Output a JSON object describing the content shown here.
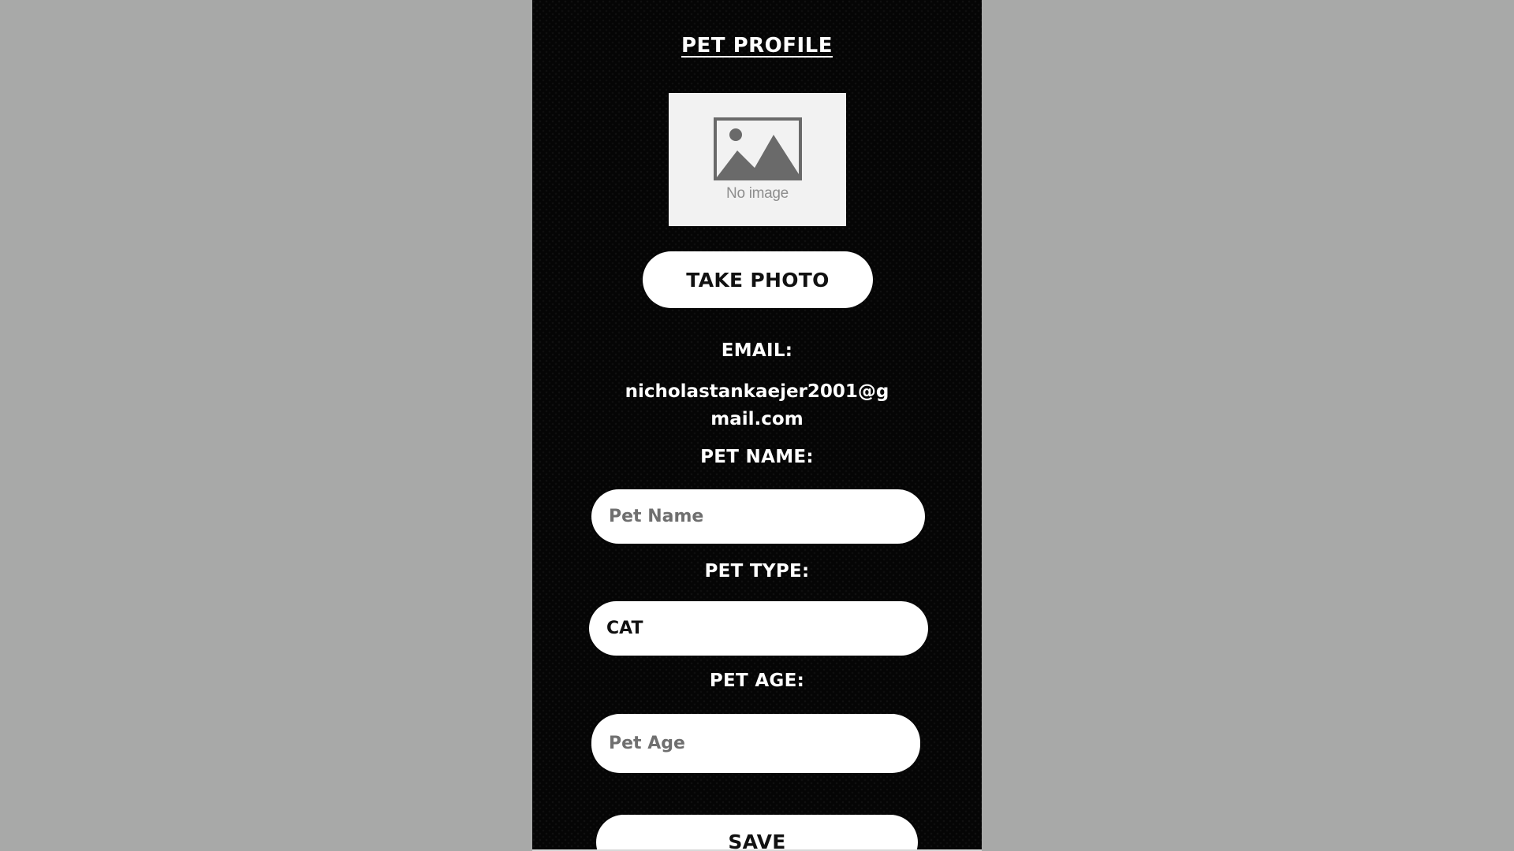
{
  "page": {
    "title": "PET PROFILE"
  },
  "photo": {
    "placeholder_text": "No image",
    "icon": "image-placeholder-icon"
  },
  "buttons": {
    "take_photo": "TAKE PHOTO",
    "save": "SAVE"
  },
  "email": {
    "label": "EMAIL:",
    "value": "nicholastankaejer2001@gmail.com"
  },
  "pet_name": {
    "label": "PET NAME:",
    "placeholder": "Pet Name",
    "value": ""
  },
  "pet_type": {
    "label": "PET TYPE:",
    "value": "CAT"
  },
  "pet_age": {
    "label": "PET AGE:",
    "placeholder": "Pet Age",
    "value": ""
  },
  "colors": {
    "background": "#a8a9a8",
    "screen": "#050505",
    "control": "#ffffff",
    "placeholder": "#6f6f6f"
  }
}
